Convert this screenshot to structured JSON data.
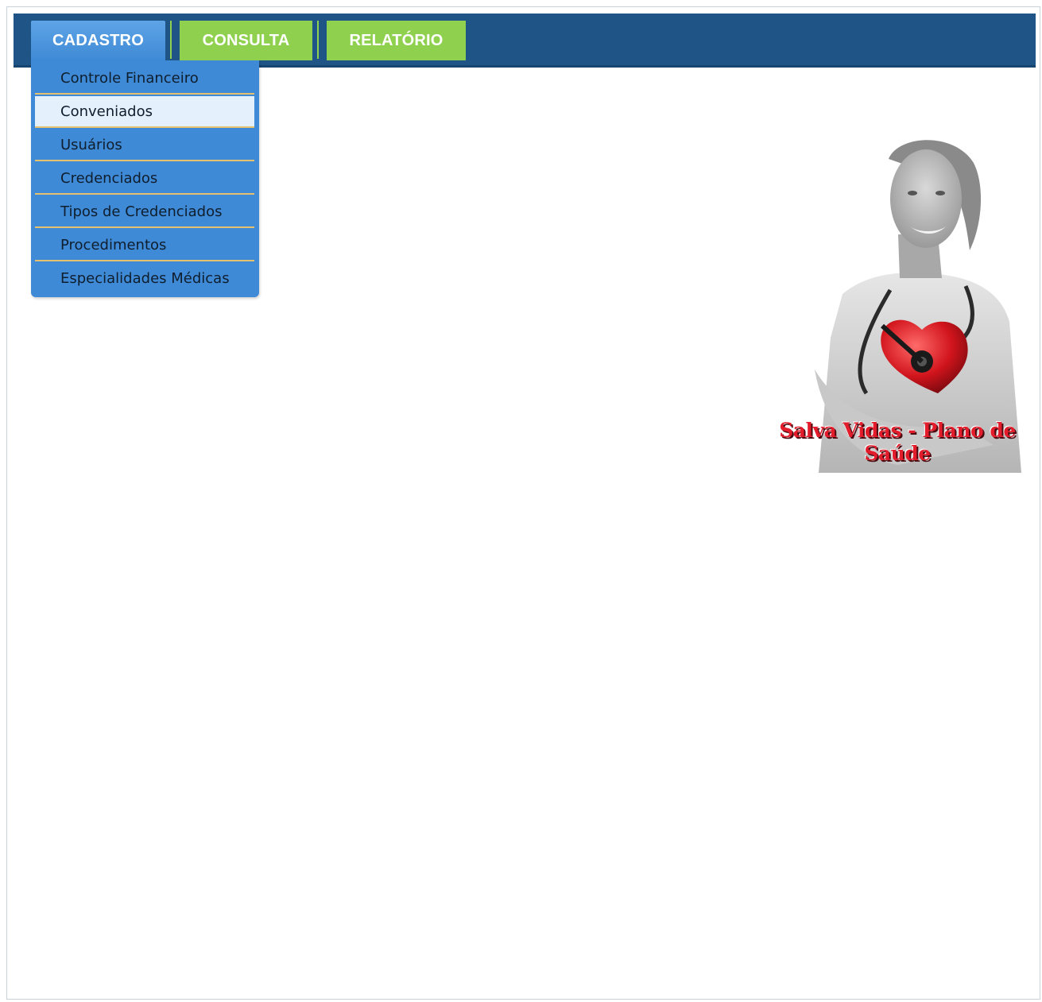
{
  "nav": {
    "tabs": [
      {
        "label": "CADASTRO",
        "active": true
      },
      {
        "label": "CONSULTA",
        "active": false
      },
      {
        "label": "RELATÓRIO",
        "active": false
      }
    ],
    "colors": {
      "bar": "#1f5586",
      "active_tab": "#3f8ad6",
      "inactive_tab": "#8fd14f",
      "menu_separator": "#e5c06f"
    }
  },
  "dropdown": {
    "items": [
      {
        "label": "Controle Financeiro"
      },
      {
        "label": "Conveniados",
        "hovered": true
      },
      {
        "label": "Usuários"
      },
      {
        "label": "Credenciados"
      },
      {
        "label": "Tipos de Credenciados"
      },
      {
        "label": "Procedimentos"
      },
      {
        "label": "Especialidades Médicas"
      }
    ]
  },
  "brand": {
    "caption": "Salva Vidas - Plano de Saúde",
    "image": "nurse-with-heart-stethoscope"
  }
}
